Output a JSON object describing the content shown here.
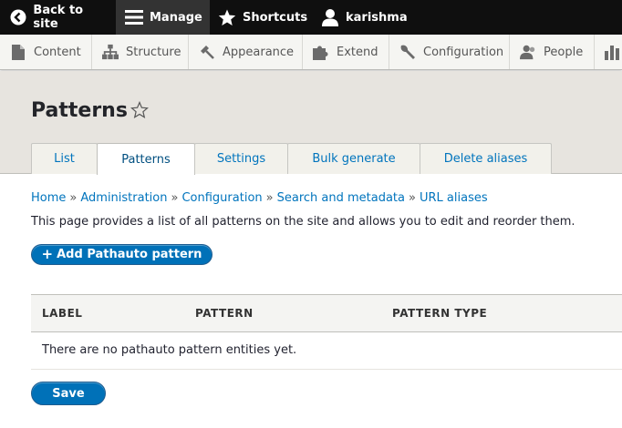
{
  "toolbar": {
    "back": {
      "label": "Back to site",
      "icon": "back-arrow-icon"
    },
    "manage": {
      "label": "Manage",
      "icon": "menu-icon"
    },
    "shortcuts": {
      "label": "Shortcuts",
      "icon": "star-icon"
    },
    "user": {
      "label": "karishma",
      "icon": "user-icon"
    }
  },
  "tray": {
    "items": [
      {
        "label": "Content",
        "icon": "file-icon"
      },
      {
        "label": "Structure",
        "icon": "structure-icon"
      },
      {
        "label": "Appearance",
        "icon": "paintbrush-icon"
      },
      {
        "label": "Extend",
        "icon": "puzzle-icon"
      },
      {
        "label": "Configuration",
        "icon": "wrench-icon"
      },
      {
        "label": "People",
        "icon": "people-icon"
      },
      {
        "label": "",
        "icon": "reports-icon"
      }
    ]
  },
  "page": {
    "title": "Patterns",
    "tabs": [
      "List",
      "Patterns",
      "Settings",
      "Bulk generate",
      "Delete aliases"
    ],
    "active_tab": "Patterns",
    "breadcrumb": [
      "Home",
      "Administration",
      "Configuration",
      "Search and metadata",
      "URL aliases"
    ],
    "breadcrumb_separator": "»",
    "description": "This page provides a list of all patterns on the site and allows you to edit and reorder them.",
    "add_button": {
      "plus": "+",
      "label": "Add Pathauto pattern"
    },
    "table": {
      "headers": [
        "LABEL",
        "PATTERN",
        "PATTERN TYPE"
      ],
      "empty_message": "There are no pathauto pattern entities yet."
    },
    "save_label": "Save"
  },
  "colors": {
    "toolbar_bg": "#0f0f0f",
    "tray_bg": "#f5f5f2",
    "header_bg": "#e7e4df",
    "link": "#0074bd",
    "button_blue": "#0071b8"
  }
}
